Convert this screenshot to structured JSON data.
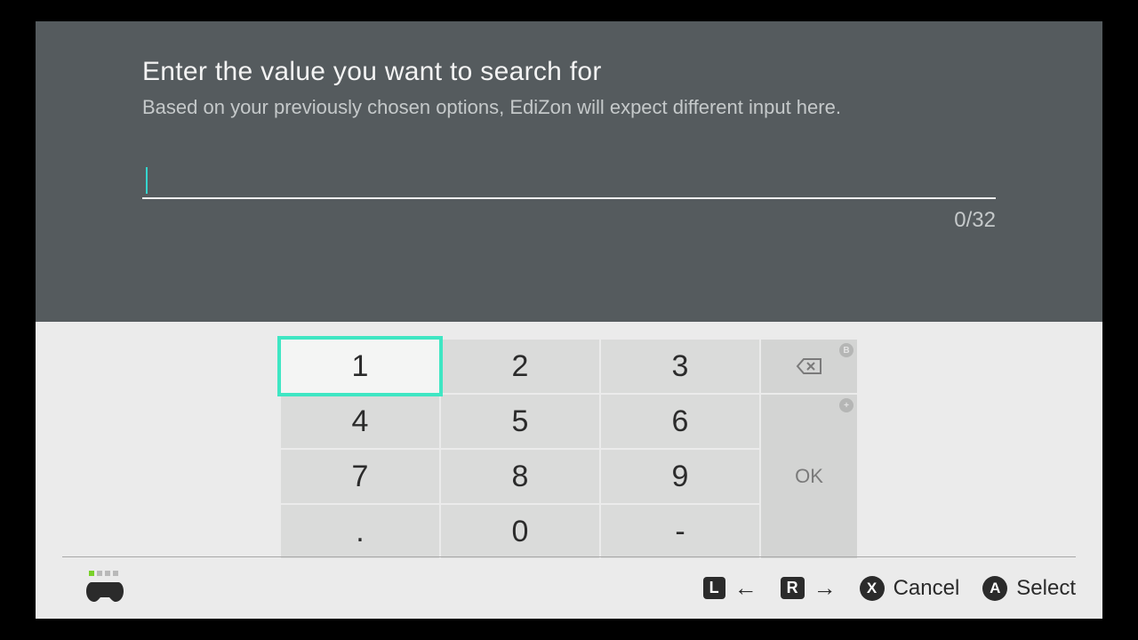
{
  "header": {
    "title": "Enter the value you want to search for",
    "subtitle": "Based on your previously chosen options, EdiZon will expect different input here."
  },
  "input": {
    "value": "",
    "counter": "0/32"
  },
  "keypad": {
    "keys": [
      "1",
      "2",
      "3",
      "4",
      "5",
      "6",
      "7",
      "8",
      "9",
      ".",
      "0",
      "-"
    ],
    "selected_index": 0,
    "backspace_badge": "B",
    "ok_label": "OK",
    "ok_badge": "+"
  },
  "footer": {
    "nav_left_badge": "L",
    "nav_right_badge": "R",
    "cancel_badge": "X",
    "cancel_label": "Cancel",
    "select_badge": "A",
    "select_label": "Select"
  }
}
